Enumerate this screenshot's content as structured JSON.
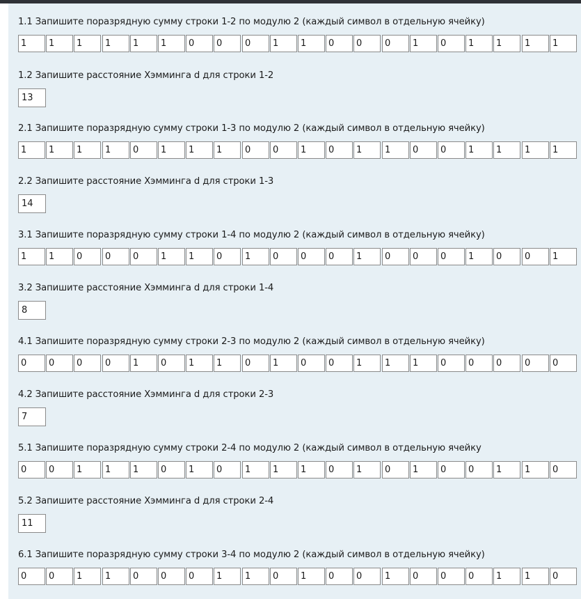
{
  "questions": [
    {
      "id": "q1-1",
      "type": "bits",
      "label": "1.1 Запишите поразрядную сумму строки 1-2 по модулю 2 (каждый символ в отдельную ячейку)",
      "values": [
        "1",
        "1",
        "1",
        "1",
        "1",
        "1",
        "0",
        "0",
        "0",
        "1",
        "1",
        "0",
        "0",
        "0",
        "1",
        "0",
        "1",
        "1",
        "1",
        "1"
      ]
    },
    {
      "id": "q1-2",
      "type": "distance",
      "label": "1.2 Запишите расстояние Хэмминга d для строки 1-2",
      "value": "13"
    },
    {
      "id": "q2-1",
      "type": "bits",
      "label": "2.1 Запишите поразрядную сумму строки 1-3 по модулю 2 (каждый символ в отдельную ячейку)",
      "values": [
        "1",
        "1",
        "1",
        "1",
        "0",
        "1",
        "1",
        "1",
        "0",
        "0",
        "1",
        "0",
        "1",
        "1",
        "0",
        "0",
        "1",
        "1",
        "1",
        "1"
      ]
    },
    {
      "id": "q2-2",
      "type": "distance",
      "label": "2.2 Запишите расстояние Хэмминга d для строки 1-3",
      "value": "14"
    },
    {
      "id": "q3-1",
      "type": "bits",
      "label": "3.1 Запишите поразрядную сумму строки 1-4 по модулю 2 (каждый символ в отдельную ячейку)",
      "values": [
        "1",
        "1",
        "0",
        "0",
        "0",
        "1",
        "1",
        "0",
        "1",
        "0",
        "0",
        "0",
        "1",
        "0",
        "0",
        "0",
        "1",
        "0",
        "0",
        "1"
      ]
    },
    {
      "id": "q3-2",
      "type": "distance",
      "label": "3.2 Запишите расстояние Хэмминга d для строки 1-4",
      "value": "8"
    },
    {
      "id": "q4-1",
      "type": "bits",
      "label": "4.1 Запишите поразрядную сумму строки 2-3 по модулю 2 (каждый символ в отдельную ячейку)",
      "values": [
        "0",
        "0",
        "0",
        "0",
        "1",
        "0",
        "1",
        "1",
        "0",
        "1",
        "0",
        "0",
        "1",
        "1",
        "1",
        "0",
        "0",
        "0",
        "0",
        "0"
      ]
    },
    {
      "id": "q4-2",
      "type": "distance",
      "label": "4.2 Запишите расстояние Хэмминга d для строки 2-3",
      "value": "7"
    },
    {
      "id": "q5-1",
      "type": "bits",
      "label": "5.1 Запишите поразрядную сумму строки 2-4 по модулю 2 (каждый символ в отдельную ячейку",
      "values": [
        "0",
        "0",
        "1",
        "1",
        "1",
        "0",
        "1",
        "0",
        "1",
        "1",
        "1",
        "0",
        "1",
        "0",
        "1",
        "0",
        "0",
        "1",
        "1",
        "0"
      ]
    },
    {
      "id": "q5-2",
      "type": "distance",
      "label": "5.2 Запишите расстояние Хэмминга d для строки 2-4",
      "value": "11"
    },
    {
      "id": "q6-1",
      "type": "bits",
      "label": "6.1 Запишите поразрядную сумму строки 3-4 по модулю 2 (каждый символ в отдельную ячейку)",
      "values": [
        "0",
        "0",
        "1",
        "1",
        "0",
        "0",
        "0",
        "1",
        "1",
        "0",
        "1",
        "0",
        "0",
        "1",
        "0",
        "0",
        "0",
        "1",
        "1",
        "0"
      ]
    }
  ]
}
